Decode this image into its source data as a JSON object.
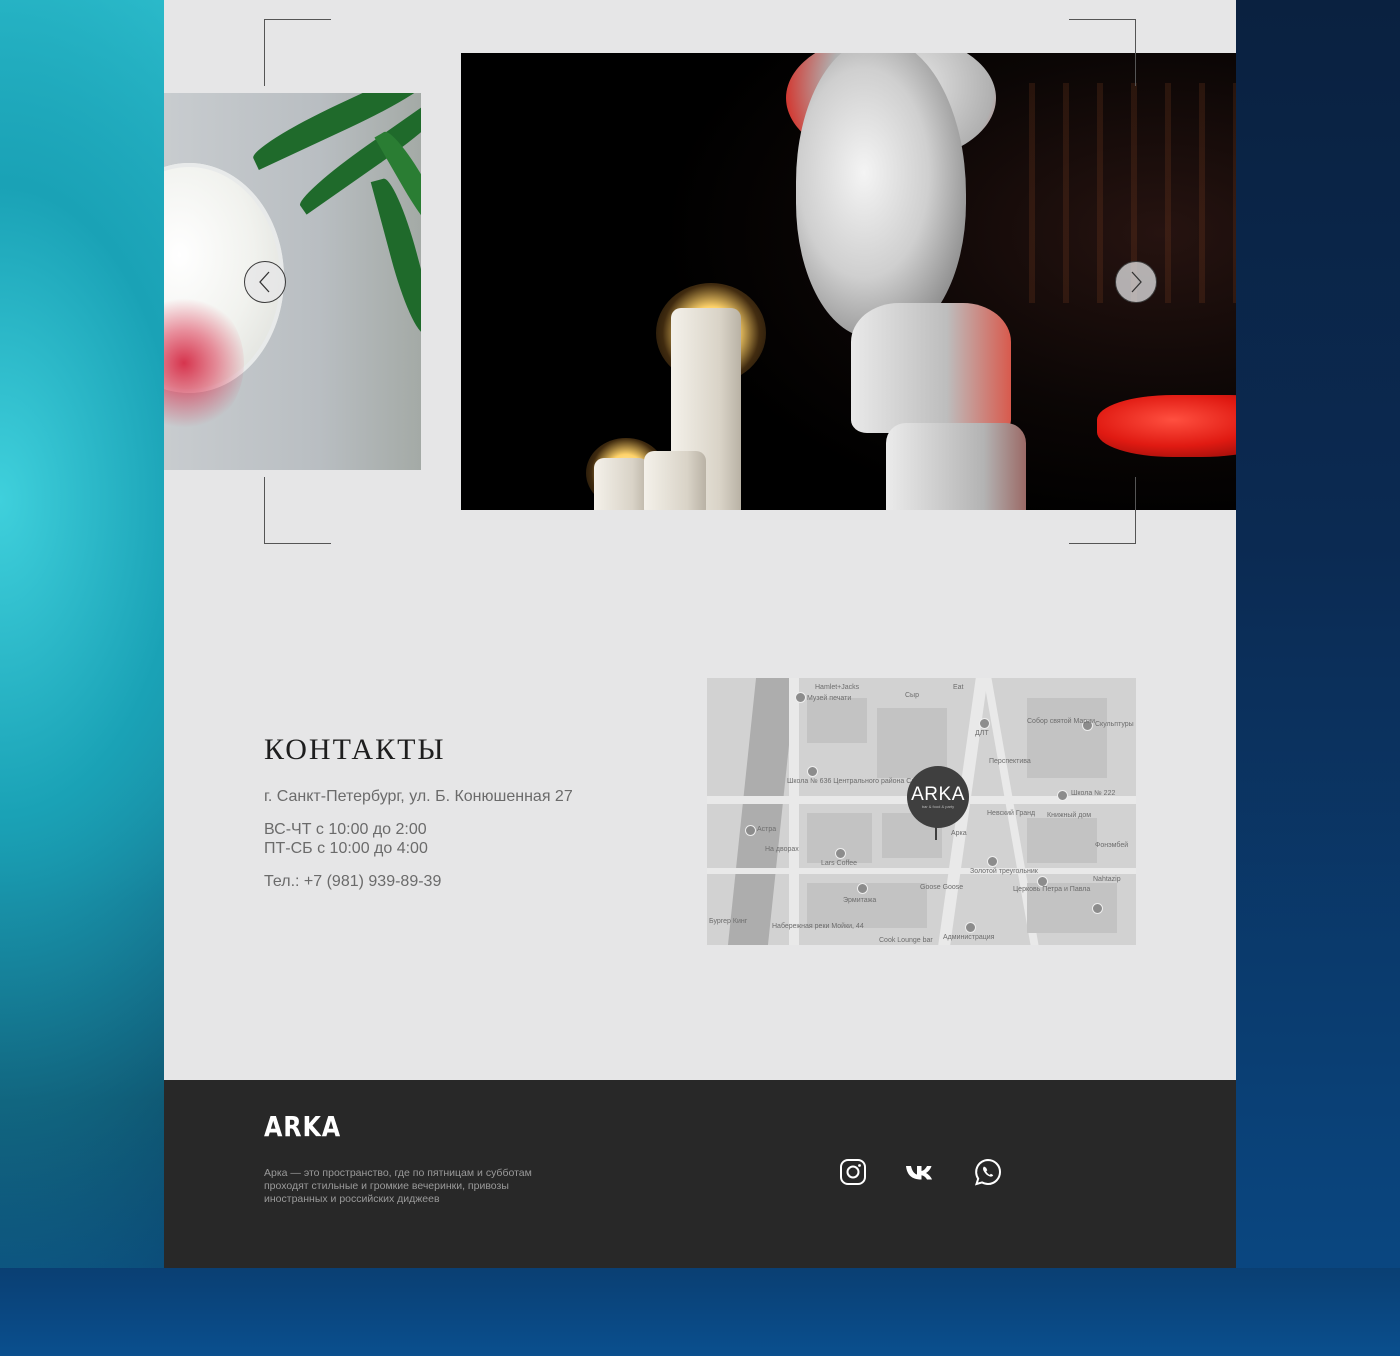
{
  "gallery": {
    "prev_label": "Previous slide",
    "next_label": "Next slide"
  },
  "contacts": {
    "title": "КОНТАКТЫ",
    "address": "г. Санкт-Петербург, ул. Б. Конюшенная 27",
    "hours_weekdays": "ВС-ЧТ с 10:00 до 2:00",
    "hours_weekend": "ПТ-СБ с 10:00 до 4:00",
    "phone": "Тел.: +7 (981) 939-89-39"
  },
  "map": {
    "pin_label": "ARKA",
    "pin_sub": "bar & food & party",
    "labels": [
      "Hamlet+Jacks",
      "Музей печати",
      "Сыр",
      "Eat",
      "Собор святой Марии",
      "Скульптуры",
      "ДЛТ",
      "Перспектива",
      "Школа № 636 Центрального района Санкт",
      "Школа № 222",
      "Невский Гранд",
      "Книжный дом",
      "Астра",
      "На дворах",
      "Lars Coffee",
      "Goose Goose",
      "Золотой треугольник",
      "Церковь Петра и Павла",
      "Nahtazip",
      "Фонэмбей",
      "Бургер Кинг",
      "Набережная реки Мойки, 44",
      "Cook Lounge bar",
      "Администрация",
      "Арка",
      "Эрмитажа"
    ]
  },
  "footer": {
    "logo": "ARKA",
    "description": "Арка — это пространство, где по пятницам и субботам проходят стильные и громкие вечеринки, привозы иностранных и российских диджеев"
  },
  "social": [
    "instagram-icon",
    "vk-icon",
    "whatsapp-icon"
  ],
  "colors": {
    "page_bg": "#e6e6e7",
    "footer_bg": "#282828",
    "accent_teal": "#3fd7e2",
    "accent_blue": "#0a4f8e"
  }
}
